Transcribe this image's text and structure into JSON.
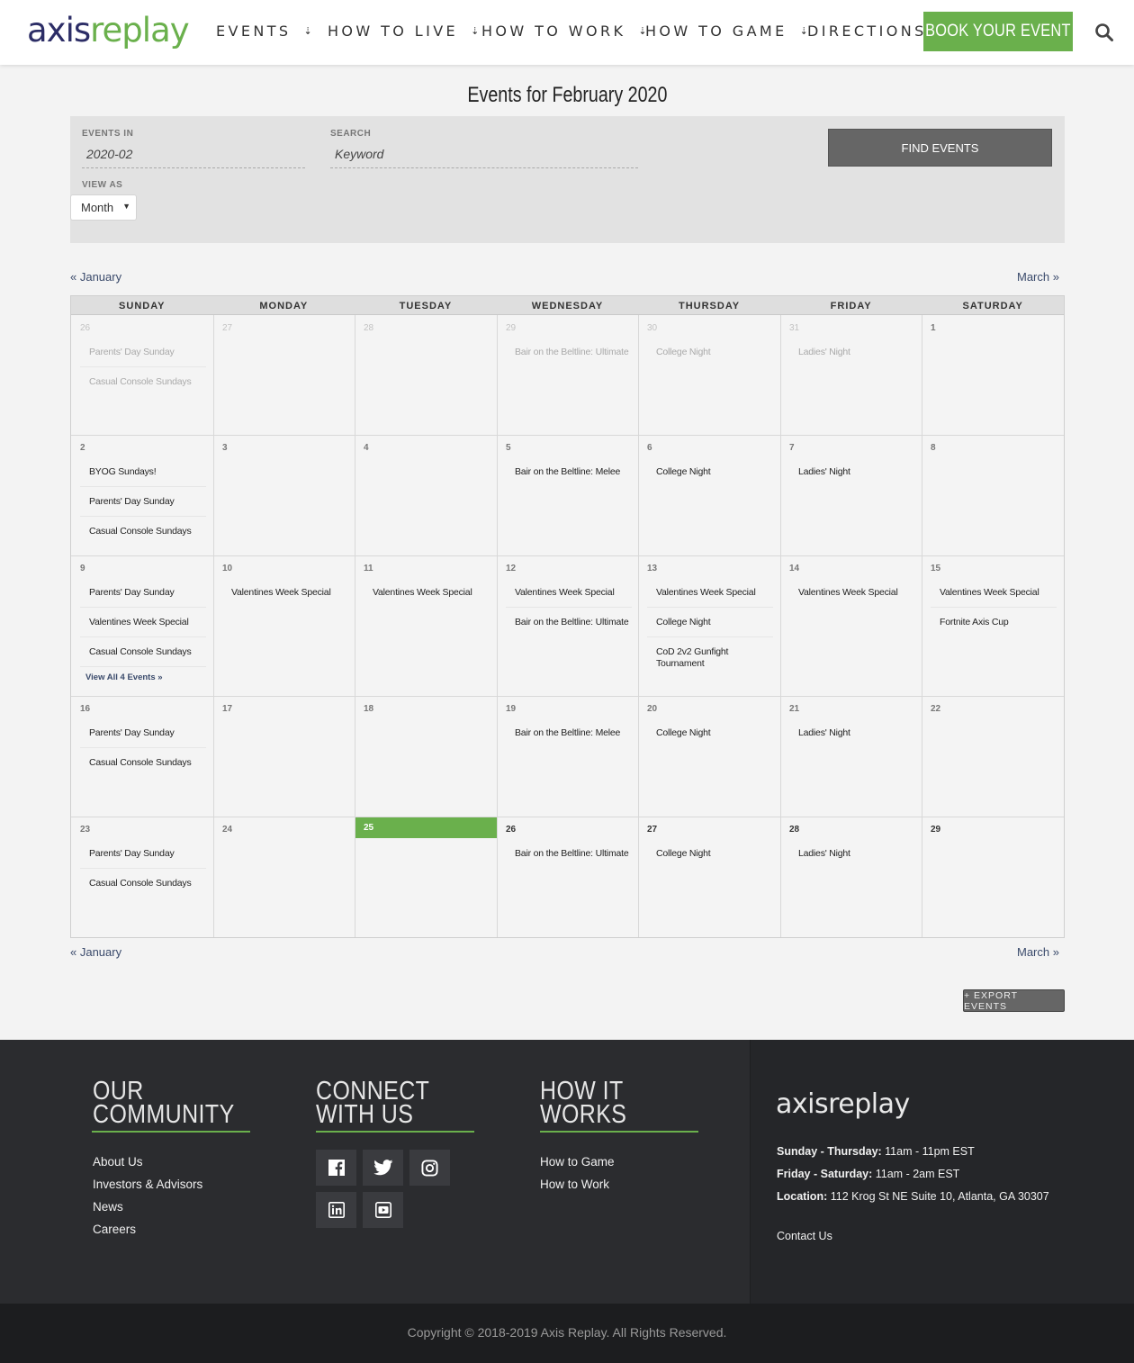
{
  "header": {
    "logo_part1": "axis",
    "logo_part2": "replay",
    "nav": [
      "EVENTS",
      "HOW TO LIVE",
      "HOW TO WORK",
      "HOW TO GAME",
      "DIRECTIONS"
    ],
    "book_label": "BOOK YOUR EVENT",
    "colors": {
      "brand_green": "#6ab04c",
      "brand_navy": "#2c2d66"
    }
  },
  "page_title": "Events for February 2020",
  "filter": {
    "events_in_label": "EVENTS IN",
    "events_in_value": "2020-02",
    "search_label": "SEARCH",
    "search_placeholder": "Keyword",
    "view_as_label": "VIEW AS",
    "view_as_value": "Month",
    "find_label": "FIND EVENTS"
  },
  "month_nav": {
    "prev": "« January",
    "next": "March »"
  },
  "calendar": {
    "days_of_week": [
      "SUNDAY",
      "MONDAY",
      "TUESDAY",
      "WEDNESDAY",
      "THURSDAY",
      "FRIDAY",
      "SATURDAY"
    ],
    "weeks": [
      [
        {
          "day": "26",
          "state": "other",
          "events": [
            "Parents' Day Sunday",
            "Casual Console Sundays"
          ]
        },
        {
          "day": "27",
          "state": "other",
          "events": []
        },
        {
          "day": "28",
          "state": "other",
          "events": []
        },
        {
          "day": "29",
          "state": "other",
          "events": [
            "Bair on the Beltline: Ultimate"
          ]
        },
        {
          "day": "30",
          "state": "other",
          "events": [
            "College Night"
          ]
        },
        {
          "day": "31",
          "state": "other",
          "events": [
            "Ladies' Night"
          ]
        },
        {
          "day": "1",
          "state": "past",
          "events": []
        }
      ],
      [
        {
          "day": "2",
          "state": "past",
          "events": [
            "BYOG Sundays!",
            "Parents' Day Sunday",
            "Casual Console Sundays"
          ]
        },
        {
          "day": "3",
          "state": "past",
          "events": []
        },
        {
          "day": "4",
          "state": "past",
          "events": []
        },
        {
          "day": "5",
          "state": "past",
          "events": [
            "Bair on the Beltline: Melee"
          ]
        },
        {
          "day": "6",
          "state": "past",
          "events": [
            "College Night"
          ]
        },
        {
          "day": "7",
          "state": "past",
          "events": [
            "Ladies' Night"
          ]
        },
        {
          "day": "8",
          "state": "past",
          "events": []
        }
      ],
      [
        {
          "day": "9",
          "state": "past",
          "events": [
            "Parents' Day Sunday",
            "Valentines Week Special",
            "Casual Console Sundays"
          ],
          "more": "View All 4 Events »"
        },
        {
          "day": "10",
          "state": "past",
          "events": [
            "Valentines Week Special"
          ]
        },
        {
          "day": "11",
          "state": "past",
          "events": [
            "Valentines Week Special"
          ]
        },
        {
          "day": "12",
          "state": "past",
          "events": [
            "Valentines Week Special",
            "Bair on the Beltline: Ultimate"
          ]
        },
        {
          "day": "13",
          "state": "past",
          "events": [
            "Valentines Week Special",
            "College Night",
            "CoD 2v2 Gunfight Tournament"
          ]
        },
        {
          "day": "14",
          "state": "past",
          "events": [
            "Valentines Week Special"
          ]
        },
        {
          "day": "15",
          "state": "past",
          "events": [
            "Valentines Week Special",
            "Fortnite Axis Cup"
          ]
        }
      ],
      [
        {
          "day": "16",
          "state": "past",
          "events": [
            "Parents' Day Sunday",
            "Casual Console Sundays"
          ]
        },
        {
          "day": "17",
          "state": "past",
          "events": []
        },
        {
          "day": "18",
          "state": "past",
          "events": []
        },
        {
          "day": "19",
          "state": "past",
          "events": [
            "Bair on the Beltline: Melee"
          ]
        },
        {
          "day": "20",
          "state": "past",
          "events": [
            "College Night"
          ]
        },
        {
          "day": "21",
          "state": "past",
          "events": [
            "Ladies' Night"
          ]
        },
        {
          "day": "22",
          "state": "past",
          "events": []
        }
      ],
      [
        {
          "day": "23",
          "state": "past",
          "events": [
            "Parents' Day Sunday",
            "Casual Console Sundays"
          ]
        },
        {
          "day": "24",
          "state": "past",
          "events": []
        },
        {
          "day": "25",
          "state": "today",
          "events": []
        },
        {
          "day": "26",
          "state": "future",
          "events": [
            "Bair on the Beltline: Ultimate"
          ]
        },
        {
          "day": "27",
          "state": "future",
          "events": [
            "College Night"
          ]
        },
        {
          "day": "28",
          "state": "future",
          "events": [
            "Ladies' Night"
          ]
        },
        {
          "day": "29",
          "state": "future",
          "events": []
        }
      ]
    ]
  },
  "export_label": "+ EXPORT EVENTS",
  "footer": {
    "community": {
      "head1": "OUR",
      "head2": "COMMUNITY",
      "links": [
        "About Us",
        "Investors & Advisors",
        "News",
        "Careers"
      ]
    },
    "connect": {
      "head1": "CONNECT",
      "head2": "WITH US",
      "icons": [
        "facebook-icon",
        "twitter-icon",
        "instagram-icon",
        "linkedin-icon",
        "youtube-icon"
      ]
    },
    "how": {
      "head1": "HOW IT",
      "head2": "WORKS",
      "links": [
        "How to Game",
        "How to Work"
      ]
    },
    "logo": "axisreplay",
    "hours1_label": "Sunday - Thursday:",
    "hours1_value": " 11am - 11pm EST",
    "hours2_label": "Friday - Saturday:",
    "hours2_value": " 11am - 2am EST",
    "location_label": "Location:",
    "location_value": " 112 Krog St NE Suite 10, Atlanta, GA 30307",
    "contact": "Contact Us",
    "copyright": "Copyright © 2018-2019 Axis Replay. All Rights Reserved."
  }
}
